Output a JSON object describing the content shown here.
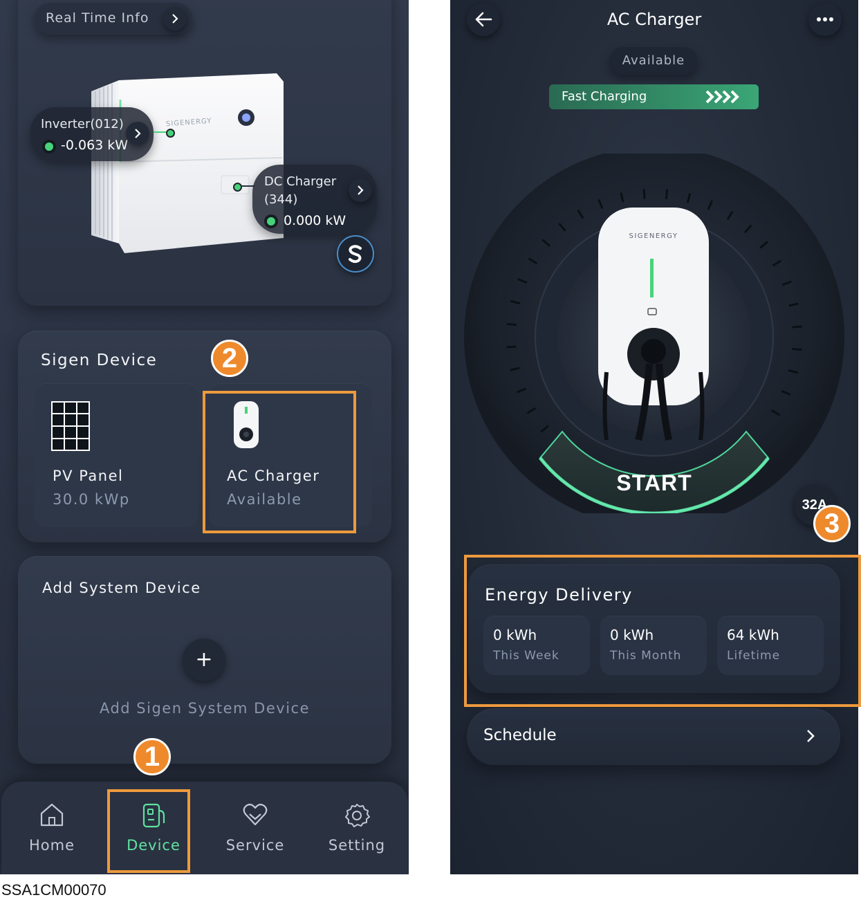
{
  "left": {
    "realtime_label": "Real Time Info",
    "inverter": {
      "label": "Inverter(012)",
      "value": "-0.063 kW"
    },
    "dc_charger": {
      "label_line1": "DC Charger",
      "label_line2": "(344)",
      "value": "0.000 kW"
    },
    "product_brand": "SIGENERGY",
    "sigen_device": {
      "title": "Sigen Device",
      "items": [
        {
          "name": "PV Panel",
          "sub": "30.0 kWp"
        },
        {
          "name": "AC Charger",
          "sub": "Available"
        }
      ]
    },
    "add_system": {
      "title": "Add System Device",
      "add_label": "Add Sigen System Device",
      "plus": "+"
    },
    "nav": [
      {
        "label": "Home",
        "icon": "home-icon"
      },
      {
        "label": "Device",
        "icon": "device-icon"
      },
      {
        "label": "Service",
        "icon": "service-icon"
      },
      {
        "label": "Setting",
        "icon": "gear-icon"
      }
    ],
    "active_nav": "Device"
  },
  "right": {
    "title": "AC Charger",
    "status": "Available",
    "fast_charging": "Fast Charging",
    "charger_brand": "SIGENERGY",
    "start_label": "START",
    "current": "32A",
    "energy": {
      "title": "Energy Delivery",
      "items": [
        {
          "value": "0 kWh",
          "label": "This Week"
        },
        {
          "value": "0 kWh",
          "label": "This Month"
        },
        {
          "value": "64 kWh",
          "label": "Lifetime"
        }
      ]
    },
    "schedule_label": "Schedule"
  },
  "badges": [
    "1",
    "2",
    "3"
  ],
  "caption": "SSA1CM00070",
  "colors": {
    "accent_green": "#47d37a",
    "highlight_orange": "#ee9a3d",
    "badge_orange": "#ee8a2c",
    "fast_charging_green": "#2f9a6a"
  }
}
